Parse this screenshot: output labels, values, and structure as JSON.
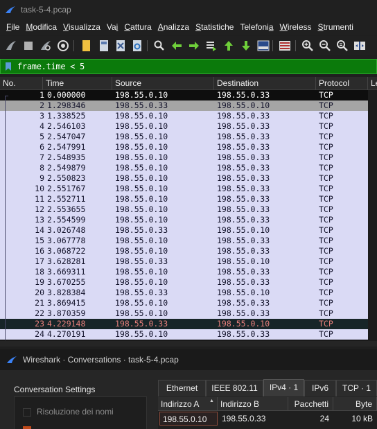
{
  "window": {
    "title": "task-5-4.pcap"
  },
  "menu": [
    {
      "pre": "",
      "u": "F",
      "post": "ile"
    },
    {
      "pre": "",
      "u": "M",
      "post": "odifica"
    },
    {
      "pre": "",
      "u": "V",
      "post": "isualizza"
    },
    {
      "pre": "Va",
      "u": "i",
      "post": ""
    },
    {
      "pre": "",
      "u": "C",
      "post": "attura"
    },
    {
      "pre": "",
      "u": "A",
      "post": "nalizza"
    },
    {
      "pre": "",
      "u": "S",
      "post": "tatistiche"
    },
    {
      "pre": "Telefoni",
      "u": "a",
      "post": ""
    },
    {
      "pre": "",
      "u": "W",
      "post": "ireless"
    },
    {
      "pre": "",
      "u": "S",
      "post": "trumenti"
    }
  ],
  "toolbar": {
    "icons": [
      "start-capture-icon",
      "stop-capture-icon",
      "restart-capture-icon",
      "capture-options-icon",
      "open-file-icon",
      "save-file-icon",
      "close-file-icon",
      "reload-file-icon",
      "find-packet-icon",
      "go-back-icon",
      "go-forward-icon",
      "go-to-packet-icon",
      "first-packet-icon",
      "last-packet-icon",
      "auto-scroll-icon",
      "colorize-icon",
      "zoom-in-icon",
      "zoom-out-icon",
      "normal-size-icon",
      "resize-columns-icon"
    ]
  },
  "filter": {
    "value": "frame.time < 5"
  },
  "packet_list": {
    "columns": [
      "No.",
      "Time",
      "Source",
      "Destination",
      "Protocol",
      "Le"
    ],
    "rows": [
      {
        "no": "1",
        "time": "0.000000",
        "src": "198.55.0.10",
        "dst": "198.55.0.33",
        "proto": "TCP",
        "style": "blk"
      },
      {
        "no": "2",
        "time": "1.298346",
        "src": "198.55.0.33",
        "dst": "198.55.0.10",
        "proto": "TCP",
        "style": "gry"
      },
      {
        "no": "3",
        "time": "1.338525",
        "src": "198.55.0.10",
        "dst": "198.55.0.33",
        "proto": "TCP",
        "style": ""
      },
      {
        "no": "4",
        "time": "2.546103",
        "src": "198.55.0.10",
        "dst": "198.55.0.33",
        "proto": "TCP",
        "style": ""
      },
      {
        "no": "5",
        "time": "2.547047",
        "src": "198.55.0.10",
        "dst": "198.55.0.33",
        "proto": "TCP",
        "style": ""
      },
      {
        "no": "6",
        "time": "2.547991",
        "src": "198.55.0.10",
        "dst": "198.55.0.33",
        "proto": "TCP",
        "style": ""
      },
      {
        "no": "7",
        "time": "2.548935",
        "src": "198.55.0.10",
        "dst": "198.55.0.33",
        "proto": "TCP",
        "style": ""
      },
      {
        "no": "8",
        "time": "2.549879",
        "src": "198.55.0.10",
        "dst": "198.55.0.33",
        "proto": "TCP",
        "style": ""
      },
      {
        "no": "9",
        "time": "2.550823",
        "src": "198.55.0.10",
        "dst": "198.55.0.33",
        "proto": "TCP",
        "style": ""
      },
      {
        "no": "10",
        "time": "2.551767",
        "src": "198.55.0.10",
        "dst": "198.55.0.33",
        "proto": "TCP",
        "style": ""
      },
      {
        "no": "11",
        "time": "2.552711",
        "src": "198.55.0.10",
        "dst": "198.55.0.33",
        "proto": "TCP",
        "style": ""
      },
      {
        "no": "12",
        "time": "2.553655",
        "src": "198.55.0.10",
        "dst": "198.55.0.33",
        "proto": "TCP",
        "style": ""
      },
      {
        "no": "13",
        "time": "2.554599",
        "src": "198.55.0.10",
        "dst": "198.55.0.33",
        "proto": "TCP",
        "style": ""
      },
      {
        "no": "14",
        "time": "3.026748",
        "src": "198.55.0.33",
        "dst": "198.55.0.10",
        "proto": "TCP",
        "style": ""
      },
      {
        "no": "15",
        "time": "3.067778",
        "src": "198.55.0.10",
        "dst": "198.55.0.33",
        "proto": "TCP",
        "style": ""
      },
      {
        "no": "16",
        "time": "3.068722",
        "src": "198.55.0.10",
        "dst": "198.55.0.33",
        "proto": "TCP",
        "style": ""
      },
      {
        "no": "17",
        "time": "3.628281",
        "src": "198.55.0.33",
        "dst": "198.55.0.10",
        "proto": "TCP",
        "style": ""
      },
      {
        "no": "18",
        "time": "3.669311",
        "src": "198.55.0.10",
        "dst": "198.55.0.33",
        "proto": "TCP",
        "style": ""
      },
      {
        "no": "19",
        "time": "3.670255",
        "src": "198.55.0.10",
        "dst": "198.55.0.33",
        "proto": "TCP",
        "style": ""
      },
      {
        "no": "20",
        "time": "3.828384",
        "src": "198.55.0.33",
        "dst": "198.55.0.10",
        "proto": "TCP",
        "style": ""
      },
      {
        "no": "21",
        "time": "3.869415",
        "src": "198.55.0.10",
        "dst": "198.55.0.33",
        "proto": "TCP",
        "style": ""
      },
      {
        "no": "22",
        "time": "3.870359",
        "src": "198.55.0.10",
        "dst": "198.55.0.33",
        "proto": "TCP",
        "style": ""
      },
      {
        "no": "23",
        "time": "4.229148",
        "src": "198.55.0.33",
        "dst": "198.55.0.10",
        "proto": "TCP",
        "style": "sel"
      },
      {
        "no": "24",
        "time": "4.270191",
        "src": "198.55.0.10",
        "dst": "198.55.0.33",
        "proto": "TCP",
        "style": ""
      }
    ]
  },
  "conversations": {
    "title": "Wireshark · Conversations · task-5-4.pcap",
    "settings_label": "Conversation Settings",
    "name_resolution_label": "Risoluzione dei nomi",
    "tabs": [
      "Ethernet",
      "IEEE 802.11",
      "IPv4 · 1",
      "IPv6",
      "TCP · 1"
    ],
    "active_tab": "IPv4 · 1",
    "columns": [
      "Indirizzo A",
      "Indirizzo B",
      "Pacchetti",
      "Byte"
    ],
    "rows": [
      {
        "a": "198.55.0.10",
        "b": "198.55.0.33",
        "packets": "24",
        "bytes": "10 kB"
      }
    ]
  },
  "colors": {
    "filter_bg": "#0b7a0b",
    "row_default": "#dadaf5",
    "row_selected_text": "#e8807c"
  }
}
